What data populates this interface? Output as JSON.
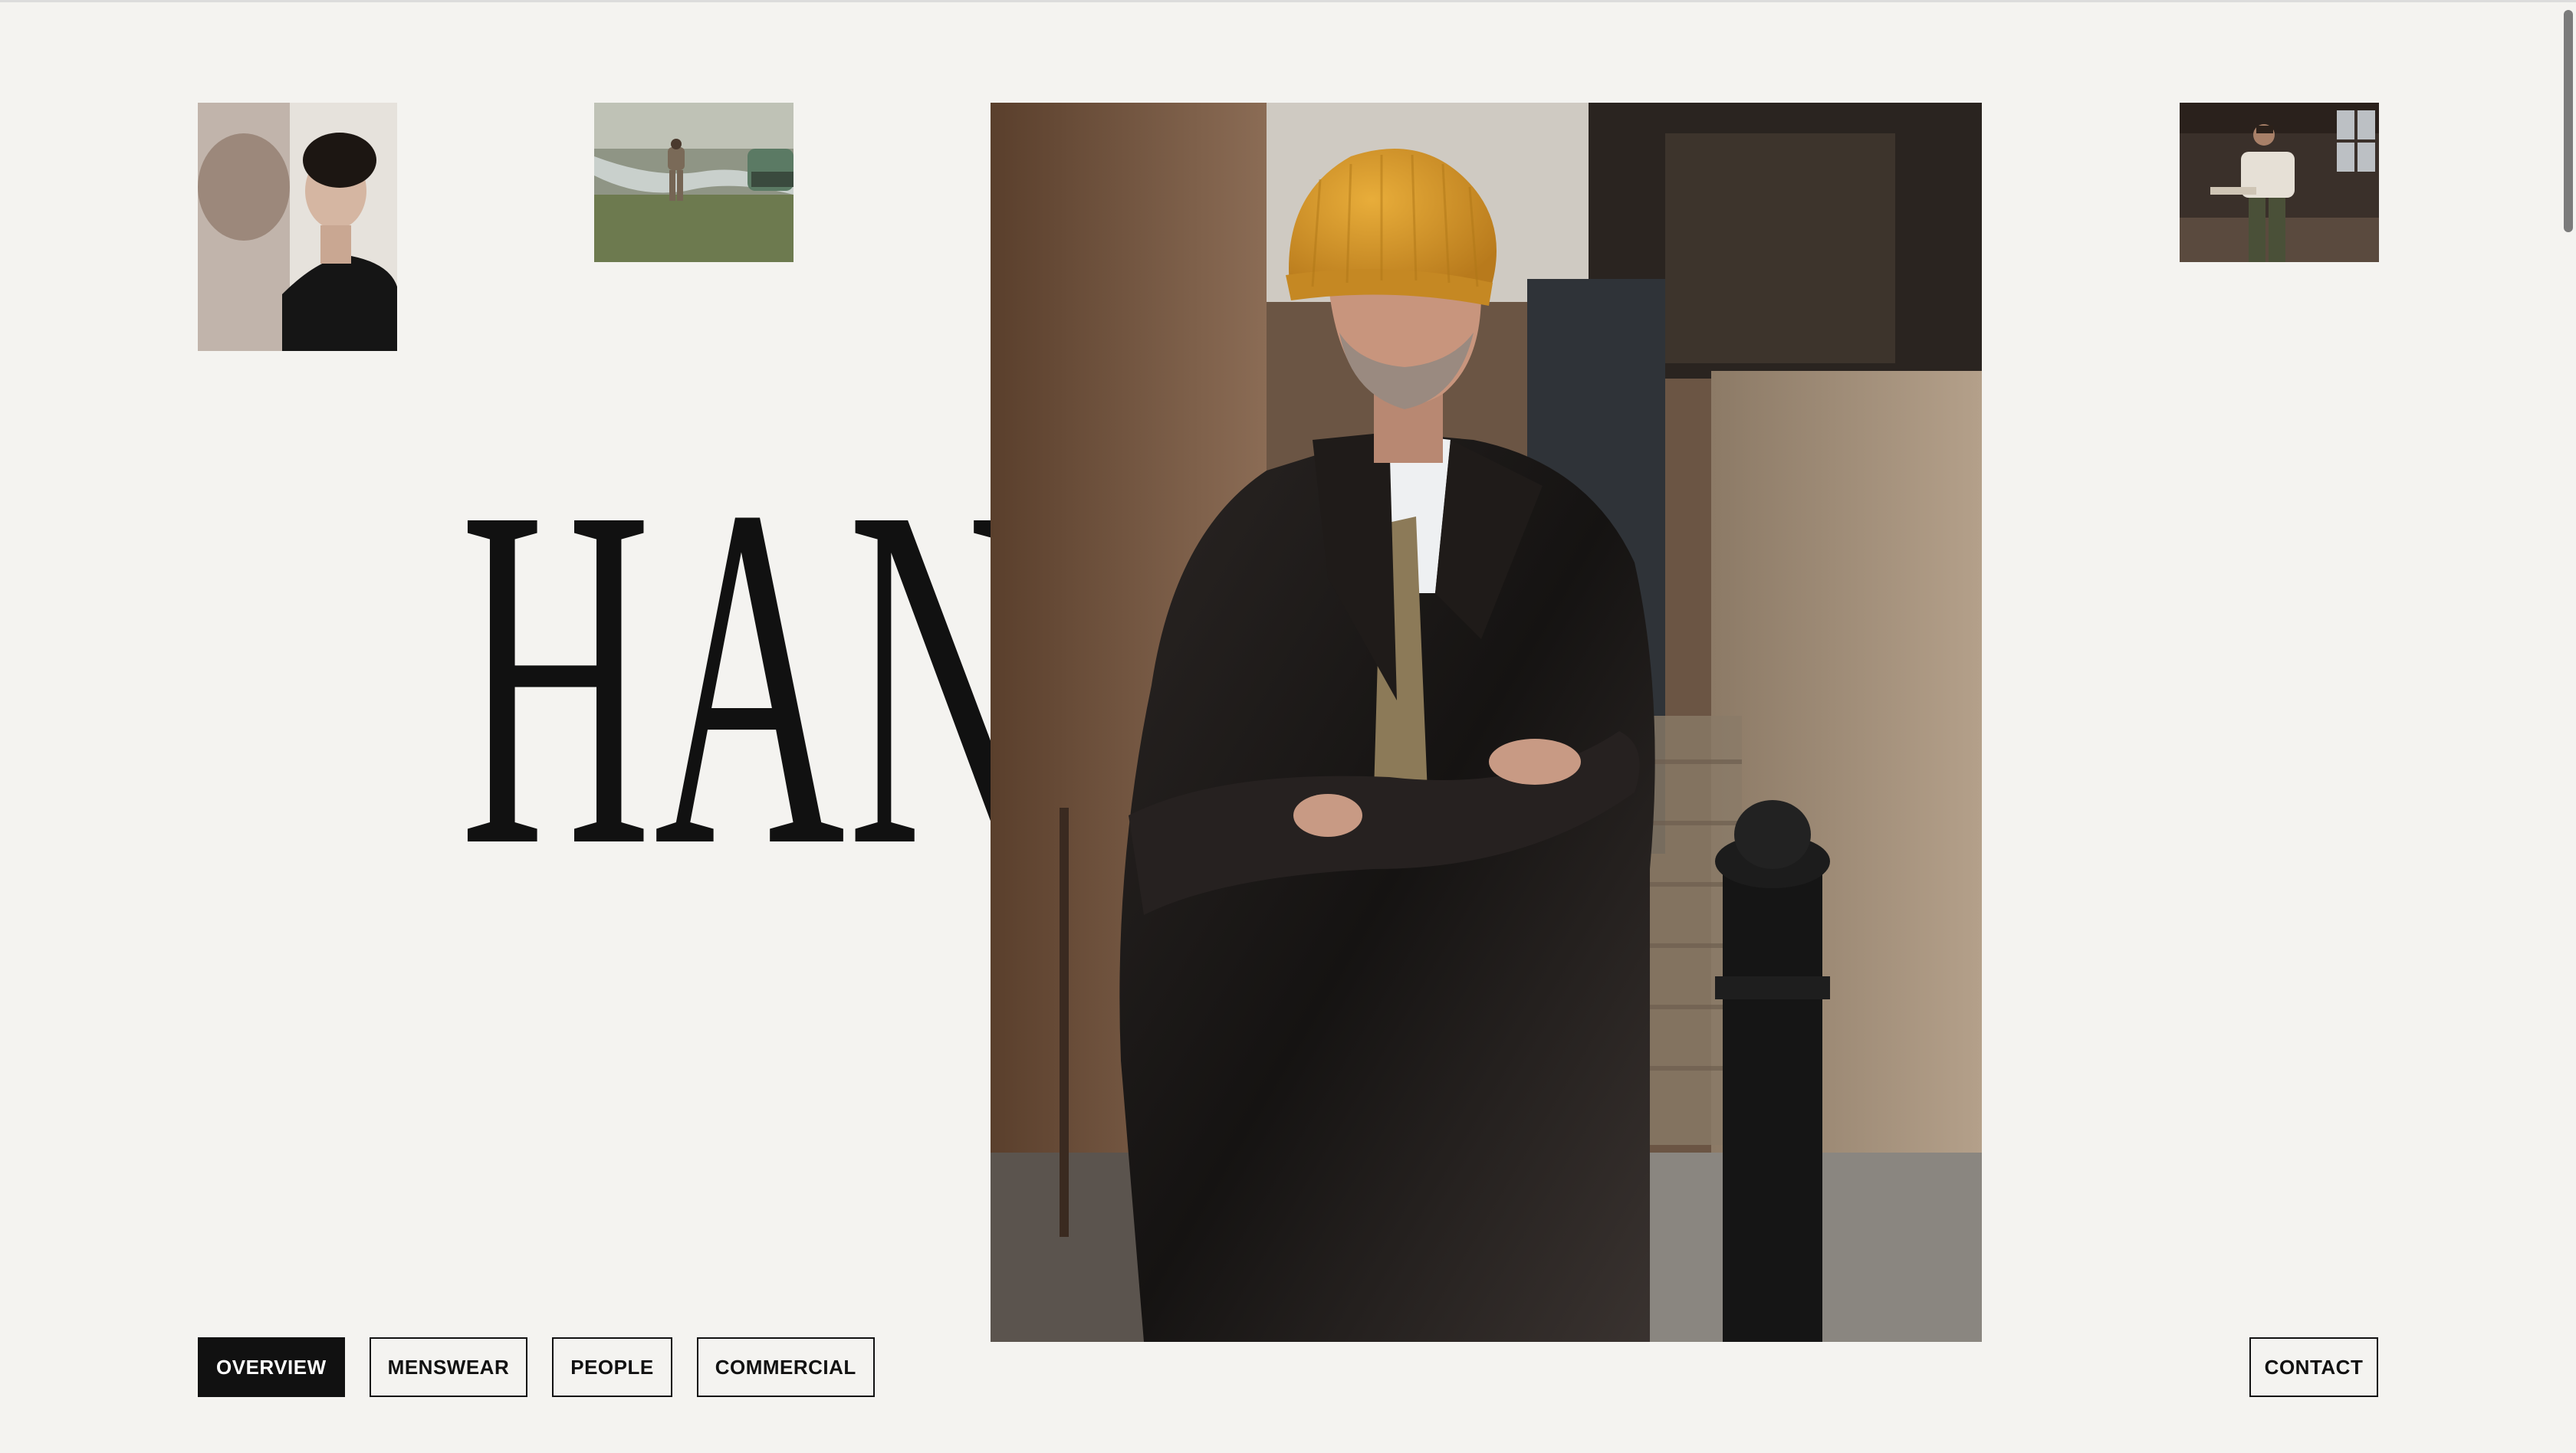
{
  "brand": {
    "wordmark": "HANNES"
  },
  "thumbnails": [
    {
      "subject": "young man with curly hair in black turtleneck"
    },
    {
      "subject": "man in suit standing on tidal shore with boat"
    },
    {
      "subject": "man in shirt on balcony by window"
    }
  ],
  "hero": {
    "subject": "man in mustard beanie and black leather coat, arms crossed"
  },
  "nav": {
    "items": [
      {
        "label": "OVERVIEW",
        "active": true
      },
      {
        "label": "MENSWEAR",
        "active": false
      },
      {
        "label": "PEOPLE",
        "active": false
      },
      {
        "label": "COMMERCIAL",
        "active": false
      }
    ],
    "contact_label": "CONTACT"
  },
  "colors": {
    "background": "#f4f3f0",
    "ink": "#111111",
    "beanie": "#d99a2b"
  }
}
